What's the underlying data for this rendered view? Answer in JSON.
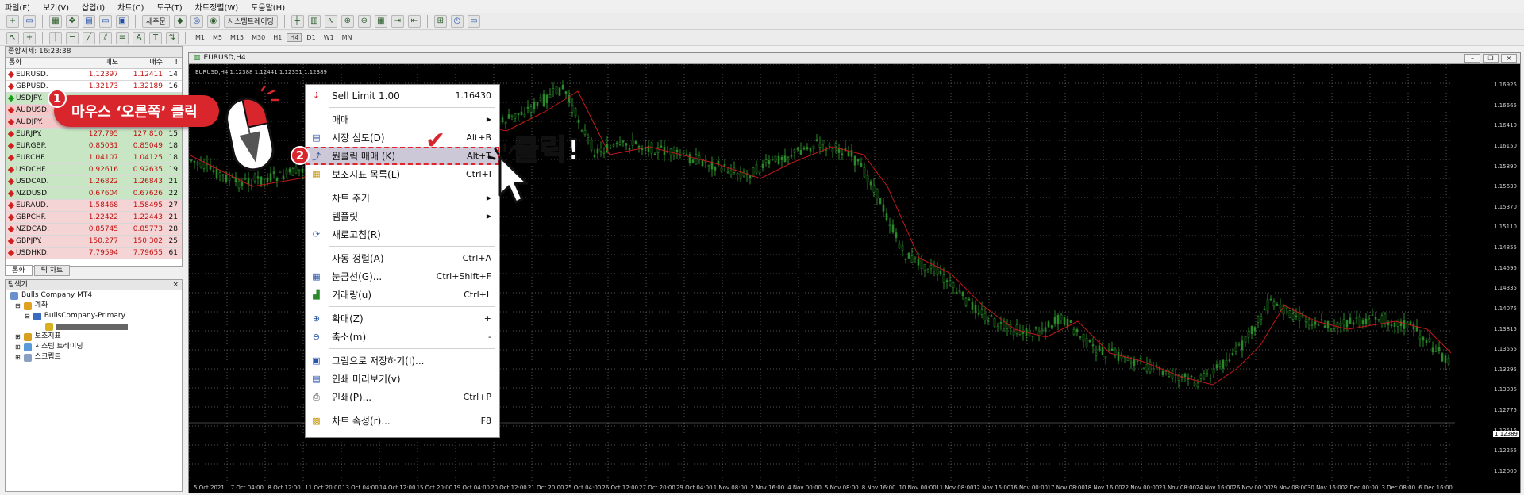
{
  "menubar": [
    "파일(F)",
    "보기(V)",
    "삽입(I)",
    "차트(C)",
    "도구(T)",
    "차트정렬(W)",
    "도움말(H)"
  ],
  "toolbar": {
    "new_order": "새주문",
    "system_trading": "시스템트레이딩"
  },
  "timeframes": [
    "M1",
    "M5",
    "M15",
    "M30",
    "H1",
    "H4",
    "D1",
    "W1",
    "MN"
  ],
  "active_timeframe": "H4",
  "market_watch": {
    "title": "종합시세: 16:23:38",
    "headers": {
      "symbol": "통화",
      "bid": "매도",
      "ask": "매수",
      "spread": "!"
    },
    "rows": [
      {
        "symbol": "EURUSD.",
        "bid": "1.12397",
        "ask": "1.12411",
        "spread": "14",
        "dir": "red"
      },
      {
        "symbol": "GBPUSD.",
        "bid": "1.32173",
        "ask": "1.32189",
        "spread": "16",
        "dir": "red"
      },
      {
        "symbol": "USDJPY.",
        "bid": "",
        "ask": "",
        "spread": "",
        "dir": "green"
      },
      {
        "symbol": "AUDUSD.",
        "bid": "",
        "ask": "",
        "spread": "",
        "dir": "red"
      },
      {
        "symbol": "AUDJPY.",
        "bid": "",
        "ask": "",
        "spread": "",
        "dir": "red"
      },
      {
        "symbol": "EURJPY.",
        "bid": "127.795",
        "ask": "127.810",
        "spread": "15",
        "dir": "red"
      },
      {
        "symbol": "EURGBP.",
        "bid": "0.85031",
        "ask": "0.85049",
        "spread": "18",
        "dir": "red"
      },
      {
        "symbol": "EURCHF.",
        "bid": "1.04107",
        "ask": "1.04125",
        "spread": "18",
        "dir": "red"
      },
      {
        "symbol": "USDCHF.",
        "bid": "0.92616",
        "ask": "0.92635",
        "spread": "19",
        "dir": "red"
      },
      {
        "symbol": "USDCAD.",
        "bid": "1.26822",
        "ask": "1.26843",
        "spread": "21",
        "dir": "red"
      },
      {
        "symbol": "NZDUSD.",
        "bid": "0.67604",
        "ask": "0.67626",
        "spread": "22",
        "dir": "red"
      },
      {
        "symbol": "EURAUD.",
        "bid": "1.58468",
        "ask": "1.58495",
        "spread": "27",
        "dir": "red"
      },
      {
        "symbol": "GBPCHF.",
        "bid": "1.22422",
        "ask": "1.22443",
        "spread": "21",
        "dir": "red"
      },
      {
        "symbol": "NZDCAD.",
        "bid": "0.85745",
        "ask": "0.85773",
        "spread": "28",
        "dir": "red"
      },
      {
        "symbol": "GBPJPY.",
        "bid": "150.277",
        "ask": "150.302",
        "spread": "25",
        "dir": "red"
      },
      {
        "symbol": "USDHKD.",
        "bid": "7.79594",
        "ask": "7.79655",
        "spread": "61",
        "dir": "red"
      }
    ],
    "tabs": [
      "통화",
      "틱 차트"
    ]
  },
  "navigator": {
    "title": "탐색기",
    "items": [
      "Bulls Company MT4",
      "계좌",
      "BullsCompany-Primary",
      "보조지표",
      "시스템 트레이딩",
      "스크립트"
    ]
  },
  "chart": {
    "title": "EURUSD,H4",
    "ohlc": "EURUSD,H4  1.12388 1.12441 1.12351 1.12389",
    "current_price": "1.12389",
    "price_labels": [
      "1.16925",
      "1.16665",
      "1.16410",
      "1.16150",
      "1.15890",
      "1.15630",
      "1.15370",
      "1.15110",
      "1.14855",
      "1.14595",
      "1.14335",
      "1.14075",
      "1.13815",
      "1.13555",
      "1.13295",
      "1.13035",
      "1.12775",
      "1.12515",
      "1.12255",
      "1.12000"
    ],
    "date_labels": [
      "5 Oct 2021",
      "7 Oct 04:00",
      "8 Oct 12:00",
      "11 Oct 20:00",
      "13 Oct 04:00",
      "14 Oct 12:00",
      "15 Oct 20:00",
      "19 Oct 04:00",
      "20 Oct 12:00",
      "21 Oct 20:00",
      "25 Oct 04:00",
      "26 Oct 12:00",
      "27 Oct 20:00",
      "29 Oct 04:00",
      "1 Nov 08:00",
      "2 Nov 16:00",
      "4 Nov 00:00",
      "5 Nov 08:00",
      "8 Nov 16:00",
      "10 Nov 00:00",
      "11 Nov 08:00",
      "12 Nov 16:00",
      "16 Nov 00:00",
      "17 Nov 08:00",
      "18 Nov 16:00",
      "22 Nov 00:00",
      "23 Nov 08:00",
      "24 Nov 16:00",
      "26 Nov 00:00",
      "29 Nov 08:00",
      "30 Nov 16:00",
      "2 Dec 00:00",
      "3 Dec 08:00",
      "6 Dec 16:00"
    ]
  },
  "context_menu": {
    "items": [
      {
        "label": "Sell Limit 1.00",
        "shortcut": "1.16430",
        "icon": "sell-limit-icon",
        "glyph": "⇣",
        "color": "#d8262c"
      },
      {
        "sep": true
      },
      {
        "label": "매매",
        "submenu": true
      },
      {
        "label": "시장 심도(D)",
        "shortcut": "Alt+B",
        "icon": "depth-icon",
        "glyph": "▤",
        "color": "#2a56a8"
      },
      {
        "label": "원클릭 매매 (K)",
        "shortcut": "Alt+T",
        "icon": "one-click-icon",
        "glyph": "⤴",
        "color": "#2a56a8",
        "highlight": true
      },
      {
        "label": "보조지표 목록(L)",
        "shortcut": "Ctrl+I",
        "icon": "indicator-list-icon",
        "glyph": "▦",
        "color": "#c89a10"
      },
      {
        "sep": true
      },
      {
        "label": "차트 주기",
        "submenu": true
      },
      {
        "label": "템플릿",
        "submenu": true
      },
      {
        "label": "새로고침(R)",
        "icon": "refresh-icon",
        "glyph": "⟳",
        "color": "#2a56a8"
      },
      {
        "sep": true
      },
      {
        "label": "자동 정렬(A)",
        "shortcut": "Ctrl+A"
      },
      {
        "label": "눈금선(G)...",
        "shortcut": "Ctrl+Shift+F",
        "icon": "grid-icon",
        "glyph": "▦",
        "color": "#2a56a8"
      },
      {
        "label": "거래량(u)",
        "shortcut": "Ctrl+L",
        "icon": "volume-icon",
        "glyph": "▟",
        "color": "#2a8a2a"
      },
      {
        "sep": true
      },
      {
        "label": "확대(Z)",
        "shortcut": "+",
        "icon": "zoom-in-icon",
        "glyph": "⊕",
        "color": "#2a56a8"
      },
      {
        "label": "축소(m)",
        "shortcut": "-",
        "icon": "zoom-out-icon",
        "glyph": "⊖",
        "color": "#2a56a8"
      },
      {
        "sep": true
      },
      {
        "label": "그림으로 저장하기(I)...",
        "icon": "save-image-icon",
        "glyph": "▣",
        "color": "#2a56a8"
      },
      {
        "label": "인쇄 미리보기(v)",
        "icon": "print-preview-icon",
        "glyph": "▤",
        "color": "#2a56a8"
      },
      {
        "label": "인쇄(P)...",
        "shortcut": "Ctrl+P",
        "icon": "print-icon",
        "glyph": "⎙",
        "color": "#555"
      },
      {
        "sep": true
      },
      {
        "label": "차트 속성(r)...",
        "shortcut": "F8",
        "icon": "chart-props-icon",
        "glyph": "▩",
        "color": "#c89a10"
      }
    ]
  },
  "annotations": {
    "step1_number": "1",
    "step1_text": "마우스 ‘오른쪽’ 클릭",
    "step2_number": "2",
    "click_text": "클릭!"
  },
  "colors": {
    "accent": "#d8262c",
    "candle": "#2a8a2a",
    "ma_line": "#c01818",
    "chart_bg": "#000000"
  }
}
